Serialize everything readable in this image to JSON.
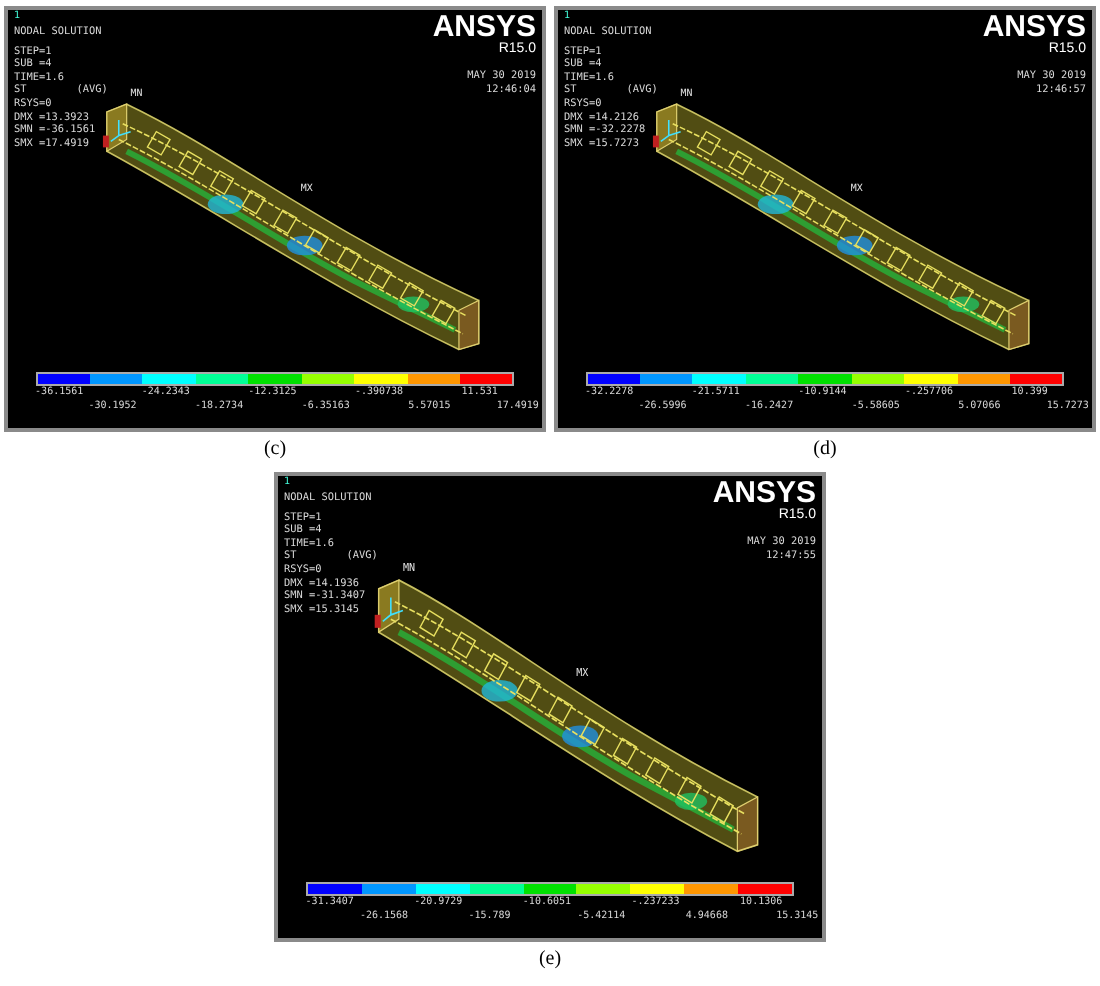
{
  "figure": {
    "panels": [
      {
        "caption": "(c)",
        "corner_number": "1",
        "title": "NODAL SOLUTION",
        "info_lines": [
          "STEP=1",
          "SUB =4",
          "TIME=1.6",
          "ST        (AVG)",
          "RSYS=0",
          "DMX =13.3923",
          "SMN =-36.1561",
          "SMX =17.4919"
        ],
        "brand": "ANSYS",
        "version": "R15.0",
        "date": "MAY 30 2019",
        "time": "12:46:04",
        "markers": [
          {
            "label": "MN"
          },
          {
            "label": "MX"
          }
        ],
        "legend": {
          "segments": [
            {
              "color": "#0000ff"
            },
            {
              "color": "#0096ff"
            },
            {
              "color": "#00ffff"
            },
            {
              "color": "#00ff96"
            },
            {
              "color": "#00e000"
            },
            {
              "color": "#96ff00"
            },
            {
              "color": "#ffff00"
            },
            {
              "color": "#ff9600"
            },
            {
              "color": "#ff0000"
            }
          ],
          "labels": [
            "-36.1561",
            "-30.1952",
            "-24.2343",
            "-18.2734",
            "-12.3125",
            "-6.35163",
            "-.390738",
            "5.57015",
            "11.531",
            "17.4919"
          ]
        }
      },
      {
        "caption": "(d)",
        "corner_number": "1",
        "title": "NODAL SOLUTION",
        "info_lines": [
          "STEP=1",
          "SUB =4",
          "TIME=1.6",
          "ST        (AVG)",
          "RSYS=0",
          "DMX =14.2126",
          "SMN =-32.2278",
          "SMX =15.7273"
        ],
        "brand": "ANSYS",
        "version": "R15.0",
        "date": "MAY 30 2019",
        "time": "12:46:57",
        "markers": [
          {
            "label": "MN"
          },
          {
            "label": "MX"
          }
        ],
        "legend": {
          "segments": [
            {
              "color": "#0000ff"
            },
            {
              "color": "#0096ff"
            },
            {
              "color": "#00ffff"
            },
            {
              "color": "#00ff96"
            },
            {
              "color": "#00e000"
            },
            {
              "color": "#96ff00"
            },
            {
              "color": "#ffff00"
            },
            {
              "color": "#ff9600"
            },
            {
              "color": "#ff0000"
            }
          ],
          "labels": [
            "-32.2278",
            "-26.5996",
            "-21.5711",
            "-16.2427",
            "-10.9144",
            "-5.58605",
            "-.257706",
            "5.07066",
            "10.399",
            "15.7273"
          ]
        }
      },
      {
        "caption": "(e)",
        "corner_number": "1",
        "title": "NODAL SOLUTION",
        "info_lines": [
          "STEP=1",
          "SUB =4",
          "TIME=1.6",
          "ST        (AVG)",
          "RSYS=0",
          "DMX =14.1936",
          "SMN =-31.3407",
          "SMX =15.3145"
        ],
        "brand": "ANSYS",
        "version": "R15.0",
        "date": "MAY 30 2019",
        "time": "12:47:55",
        "markers": [
          {
            "label": "MN"
          },
          {
            "label": "MX"
          }
        ],
        "legend": {
          "segments": [
            {
              "color": "#0000ff"
            },
            {
              "color": "#0096ff"
            },
            {
              "color": "#00ffff"
            },
            {
              "color": "#00ff96"
            },
            {
              "color": "#00e000"
            },
            {
              "color": "#96ff00"
            },
            {
              "color": "#ffff00"
            },
            {
              "color": "#ff9600"
            },
            {
              "color": "#ff0000"
            }
          ],
          "labels": [
            "-31.3407",
            "-26.1568",
            "-20.9729",
            "-15.789",
            "-10.6051",
            "-5.42114",
            "-.237233",
            "4.94668",
            "10.1306",
            "15.3145"
          ]
        }
      }
    ]
  }
}
